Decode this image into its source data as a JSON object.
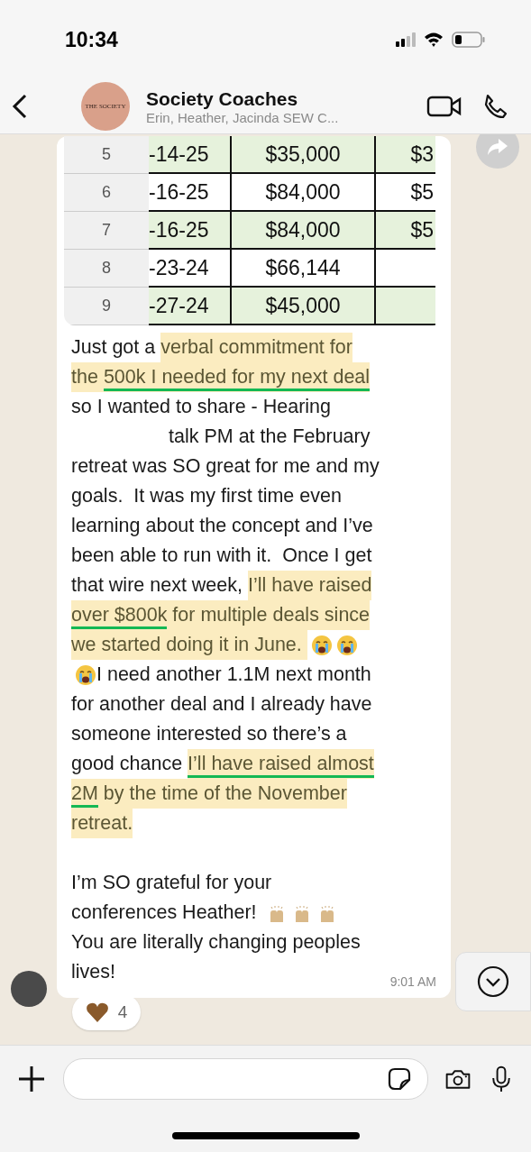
{
  "status_bar": {
    "time": "10:34"
  },
  "header": {
    "title": "Society Coaches",
    "subtitle": "Erin, Heather, Jacinda SEW C...",
    "avatar_text": "THE SOCIETY"
  },
  "table": {
    "rows": [
      {
        "row_number": "5",
        "column_2": "-14-25",
        "column_3": "$35,000",
        "column_4": "$3",
        "shaded": true
      },
      {
        "row_number": "6",
        "column_2": "-16-25",
        "column_3": "$84,000",
        "column_4": "$5",
        "shaded": false
      },
      {
        "row_number": "7",
        "column_2": "-16-25",
        "column_3": "$84,000",
        "column_4": "$5",
        "shaded": true
      },
      {
        "row_number": "8",
        "column_2": "-23-24",
        "column_3": "$66,144",
        "shaded": false
      },
      {
        "row_number": "9",
        "column_2": "-27-24",
        "column_3": "$45,000",
        "shaded": true
      }
    ]
  },
  "message": {
    "paragraphs": [
      [
        {
          "parts": [
            {
              "kind": "text",
              "segments": [
                {
                  "text": "Just got a ",
                  "highlighted": false,
                  "underlined": false
                },
                {
                  "text": "verbal commitment for",
                  "highlighted": true,
                  "underlined": false
                }
              ]
            }
          ]
        },
        {
          "parts": [
            {
              "kind": "text",
              "segments": [
                {
                  "text": "the ",
                  "highlighted": true,
                  "underlined": false
                },
                {
                  "text": "500k I needed for my next deal",
                  "highlighted": true,
                  "underlined": true
                }
              ]
            }
          ]
        },
        {
          "parts": [
            {
              "kind": "text",
              "segments": [
                {
                  "text": "so I wanted to share - Hearing",
                  "highlighted": false,
                  "underlined": false
                }
              ]
            }
          ]
        },
        {
          "indented": true,
          "parts": [
            {
              "kind": "text",
              "segments": [
                {
                  "text": "talk PM at the February",
                  "highlighted": false,
                  "underlined": false
                }
              ]
            }
          ]
        },
        {
          "parts": [
            {
              "kind": "text",
              "segments": [
                {
                  "text": "retreat was SO great for me and my",
                  "highlighted": false,
                  "underlined": false
                }
              ]
            }
          ]
        },
        {
          "parts": [
            {
              "kind": "text",
              "segments": [
                {
                  "text": "goals.  It was my first time even",
                  "highlighted": false,
                  "underlined": false
                }
              ]
            }
          ]
        },
        {
          "parts": [
            {
              "kind": "text",
              "segments": [
                {
                  "text": "learning about the concept and I’ve",
                  "highlighted": false,
                  "underlined": false
                }
              ]
            }
          ]
        },
        {
          "parts": [
            {
              "kind": "text",
              "segments": [
                {
                  "text": "been able to run with it.  Once I get",
                  "highlighted": false,
                  "underlined": false
                }
              ]
            }
          ]
        },
        {
          "parts": [
            {
              "kind": "text",
              "segments": [
                {
                  "text": "that wire next week, ",
                  "highlighted": false,
                  "underlined": false
                },
                {
                  "text": "I’ll have raised",
                  "highlighted": true,
                  "underlined": false
                }
              ]
            }
          ]
        },
        {
          "parts": [
            {
              "kind": "text",
              "segments": [
                {
                  "text": "over $800k",
                  "highlighted": true,
                  "underlined": true
                },
                {
                  "text": " for multiple deals since",
                  "highlighted": true,
                  "underlined": false
                }
              ]
            }
          ]
        },
        {
          "parts": [
            {
              "kind": "text",
              "segments": [
                {
                  "text": "we started doing it in June. ",
                  "highlighted": true,
                  "underlined": false
                }
              ]
            },
            {
              "kind": "crying_emoji"
            },
            {
              "kind": "crying_emoji"
            }
          ]
        },
        {
          "parts": [
            {
              "kind": "crying_emoji"
            },
            {
              "kind": "text",
              "segments": [
                {
                  "text": "I need another 1.1M next month",
                  "highlighted": false,
                  "underlined": false
                }
              ]
            }
          ]
        },
        {
          "parts": [
            {
              "kind": "text",
              "segments": [
                {
                  "text": "for another deal and I already have",
                  "highlighted": false,
                  "underlined": false
                }
              ]
            }
          ]
        },
        {
          "parts": [
            {
              "kind": "text",
              "segments": [
                {
                  "text": "someone interested so there’s a",
                  "highlighted": false,
                  "underlined": false
                }
              ]
            }
          ]
        },
        {
          "parts": [
            {
              "kind": "text",
              "segments": [
                {
                  "text": "good chance ",
                  "highlighted": false,
                  "underlined": false
                },
                {
                  "text": "I’ll have raised almost",
                  "highlighted": true,
                  "underlined": true
                }
              ]
            }
          ]
        },
        {
          "parts": [
            {
              "kind": "text",
              "segments": [
                {
                  "text": "2M",
                  "highlighted": true,
                  "underlined": true
                },
                {
                  "text": " by the time of the November",
                  "highlighted": true,
                  "underlined": false
                }
              ]
            }
          ]
        },
        {
          "parts": [
            {
              "kind": "text",
              "segments": [
                {
                  "text": "retreat.",
                  "highlighted": true,
                  "underlined": false
                }
              ]
            }
          ]
        }
      ],
      [
        {
          "parts": [
            {
              "kind": "text",
              "segments": [
                {
                  "text": "I’m SO grateful for your",
                  "highlighted": false,
                  "underlined": false
                }
              ]
            }
          ]
        },
        {
          "parts": [
            {
              "kind": "text",
              "segments": [
                {
                  "text": "conferences Heather! ",
                  "highlighted": false,
                  "underlined": false
                }
              ]
            },
            {
              "kind": "raised_hands_emoji"
            },
            {
              "kind": "raised_hands_emoji"
            },
            {
              "kind": "raised_hands_emoji"
            }
          ]
        },
        {
          "parts": [
            {
              "kind": "text",
              "segments": [
                {
                  "text": "You are literally changing peoples",
                  "highlighted": false,
                  "underlined": false
                }
              ]
            }
          ]
        },
        {
          "parts": [
            {
              "kind": "text",
              "segments": [
                {
                  "text": "lives!",
                  "highlighted": false,
                  "underlined": false
                }
              ]
            }
          ]
        }
      ]
    ],
    "time": "9:01 AM",
    "reaction": {
      "count": "4"
    }
  }
}
